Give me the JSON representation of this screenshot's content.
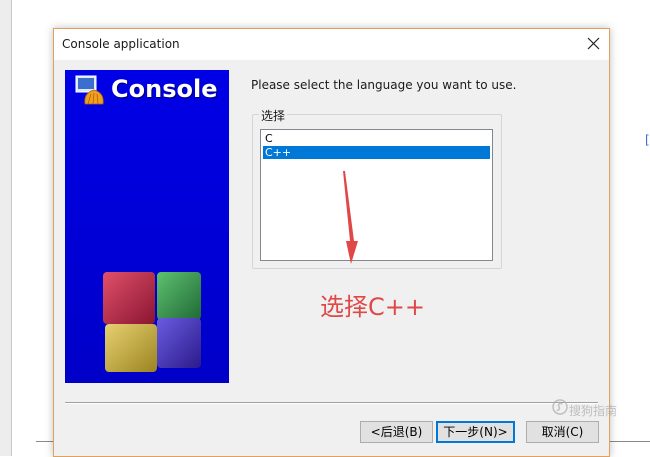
{
  "dialog": {
    "title": "Console application",
    "banner_title": "Console",
    "prompt": "Please select the language you want to use.",
    "group_label": "选择",
    "languages": [
      {
        "label": "C",
        "selected": false
      },
      {
        "label": "C++",
        "selected": true
      }
    ],
    "buttons": {
      "back": "<后退(B)",
      "next": "下一步(N)>",
      "cancel": "取消(C)"
    }
  },
  "annotation": {
    "text": "选择C++",
    "color": "#e04848"
  },
  "watermark": {
    "text": "搜狗指南"
  },
  "colors": {
    "banner_blue": "#0000e6",
    "selection": "#0078d7",
    "dialog_border": "#e0a060"
  }
}
